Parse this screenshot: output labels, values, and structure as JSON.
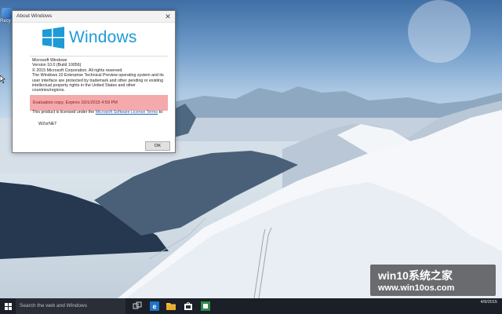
{
  "desktop": {
    "icon_label": "Recy"
  },
  "dialog": {
    "title": "About Windows",
    "close_glyph": "✕",
    "logo_text": "Windows",
    "product": "Microsoft Windows",
    "version": "Version 10.0 (Build 10056)",
    "copyright": "© 2015 Microsoft Corporation. All rights reserved.",
    "legal": "The Windows 10 Enterprise Technical Preview operating system and its user interface are protected by trademark and other pending or existing intellectual property rights in the United States and other countries/regions.",
    "evaluation": "Evaluation copy. Expires 10/1/2015 4:59 PM",
    "license_prefix": "This product is licensed under the",
    "license_link": "Microsoft Software License Terms",
    "license_suffix": "to:",
    "licensee": "WZorNET",
    "ok_label": "OK"
  },
  "watermark": {
    "line1": "win10系统之家",
    "line2": "www.win10os.com"
  },
  "taskbar": {
    "search_placeholder": "Search the web and Windows",
    "time": "",
    "date": "4/9/2015"
  },
  "colors": {
    "accent": "#1e9ad6",
    "taskbar": "#1b1f27",
    "eval_bg": "#f4a9ab"
  }
}
